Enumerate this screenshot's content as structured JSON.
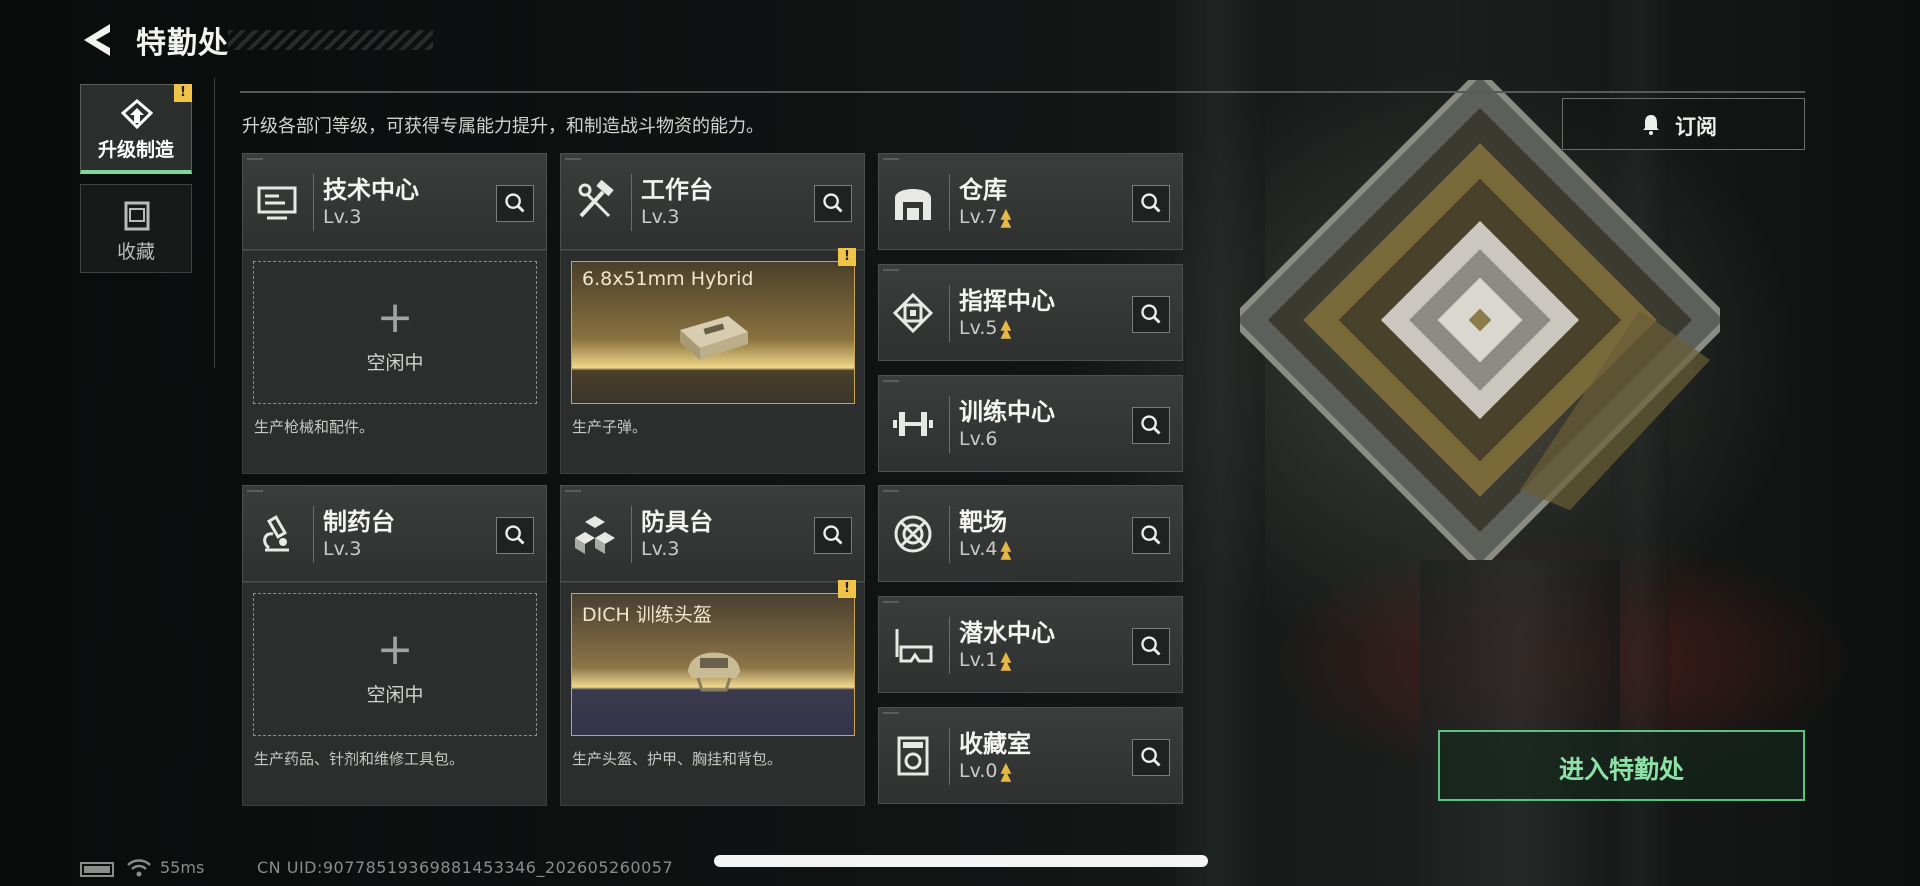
{
  "header": {
    "title": "特勤处"
  },
  "nav": {
    "items": [
      {
        "label": "升级制造",
        "icon": "upgrade-icon",
        "active": true,
        "warning": "!"
      },
      {
        "label": "收藏",
        "icon": "collection-icon",
        "active": false
      }
    ]
  },
  "description": "升级各部门等级，可获得专属能力提升，和制造战斗物资的能力。",
  "subscribe": {
    "label": "订阅",
    "icon": "bell-icon"
  },
  "workshops": [
    {
      "name": "技术中心",
      "level": "Lv.3",
      "icon": "tech-center-icon",
      "slot_status": "空闲中",
      "slot_desc": "生产枪械和配件。"
    },
    {
      "name": "工作台",
      "level": "Lv.3",
      "icon": "workbench-icon",
      "production": "6.8x51mm Hybrid",
      "slot_desc": "生产子弹。",
      "warning": "!"
    },
    {
      "name": "制药台",
      "level": "Lv.3",
      "icon": "pharmacy-icon",
      "slot_status": "空闲中",
      "slot_desc": "生产药品、针剂和维修工具包。"
    },
    {
      "name": "防具台",
      "level": "Lv.3",
      "icon": "armor-bench-icon",
      "production": "DICH 训练头盔",
      "slot_desc": "生产头盔、护甲、胸挂和背包。",
      "warning": "!"
    }
  ],
  "facilities": [
    {
      "name": "仓库",
      "level": "Lv.7",
      "icon": "warehouse-icon",
      "upgradable": true
    },
    {
      "name": "指挥中心",
      "level": "Lv.5",
      "icon": "command-center-icon",
      "upgradable": true
    },
    {
      "name": "训练中心",
      "level": "Lv.6",
      "icon": "training-center-icon",
      "upgradable": false
    },
    {
      "name": "靶场",
      "level": "Lv.4",
      "icon": "shooting-range-icon",
      "upgradable": true
    },
    {
      "name": "潜水中心",
      "level": "Lv.1",
      "icon": "diving-center-icon",
      "upgradable": true
    },
    {
      "name": "收藏室",
      "level": "Lv.0",
      "icon": "collection-room-icon",
      "upgradable": true
    }
  ],
  "enter_button": {
    "label": "进入特勤处"
  },
  "status_bar": {
    "ping": "55ms",
    "uid": "CN UID:90778519369881453346_202605260057"
  },
  "colors": {
    "accent_green": "#59c47d",
    "warning_yellow": "#f0c44a",
    "upgrade_gold": "#e8b847"
  }
}
